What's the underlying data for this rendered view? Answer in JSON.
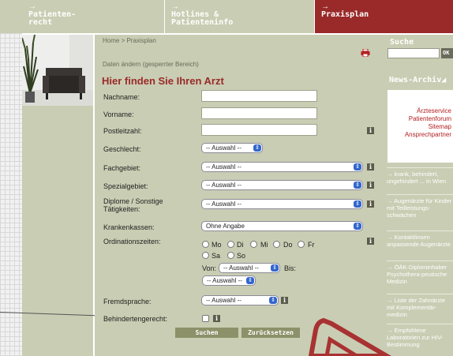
{
  "nav": {
    "tabs": [
      {
        "arrow": "→",
        "line1": "Patienten-",
        "line2": "recht"
      },
      {
        "arrow": "→",
        "line1": "Hotlines &",
        "line2": "Patienteninfo"
      },
      {
        "arrow": "→",
        "line1": "",
        "line2": "Praxisplan"
      }
    ]
  },
  "breadcrumb": "Home > Praxisplan",
  "subtitle": "Daten ändern (gesperrter Bereich)",
  "heading": "Hier finden Sie Ihren Arzt",
  "form": {
    "nachname": "Nachname:",
    "vorname": "Vorname:",
    "postleitzahl": "Postleitzahl:",
    "geschlecht": "Geschlecht:",
    "fachgebiet": "Fachgebiet:",
    "spezialgebiet": "Spezialgebiet:",
    "diplome_1": "Diplome / Sonstige",
    "diplome_2": "Tätigkeiten:",
    "krankenkassen": "Krankenkassen:",
    "ordinationszeiten": "Ordinationszeiten:",
    "fremdsprache": "Fremdsprache:",
    "behindertengerecht": "Behindertengerecht:",
    "auswahl_short": "-- Auswahl --",
    "auswahl_long": "-- Auswahl --",
    "ohne_angabe": "Ohne Angabe",
    "days": [
      "Mo",
      "Di",
      "Mi",
      "Do",
      "Fr",
      "Sa",
      "So"
    ],
    "von": "Von:",
    "bis": "Bis:",
    "info_glyph": "i",
    "suchen": "Suchen",
    "zuruecksetzen": "Zurücksetzen"
  },
  "right": {
    "suche": "Suche",
    "ok": "OK",
    "news_title": "News-Archiv",
    "links": [
      "Ärzteservice",
      "Patientenforum",
      "Sitemap",
      "Ansprechpartner"
    ],
    "news": [
      "→ krank, behindert, ungehindert ... in Wien",
      "→ Augenärzte für Kinder mit Teilleistungs-schwächen",
      "→ Kontaktlinsen anpassende Augenärzte",
      "→ ÖÄK-Diplominhaber Psychothera-peutische Medizin",
      "→ Liste der Zahnärzte mit Komplementär-medizin",
      "→ Empfohlene Laboratorien zur HIV-Bestimmung"
    ]
  },
  "colors": {
    "olive": "#c9cdb3",
    "accent_red": "#9a2a2a",
    "button": "#8c9169",
    "link_red": "#b32020"
  }
}
